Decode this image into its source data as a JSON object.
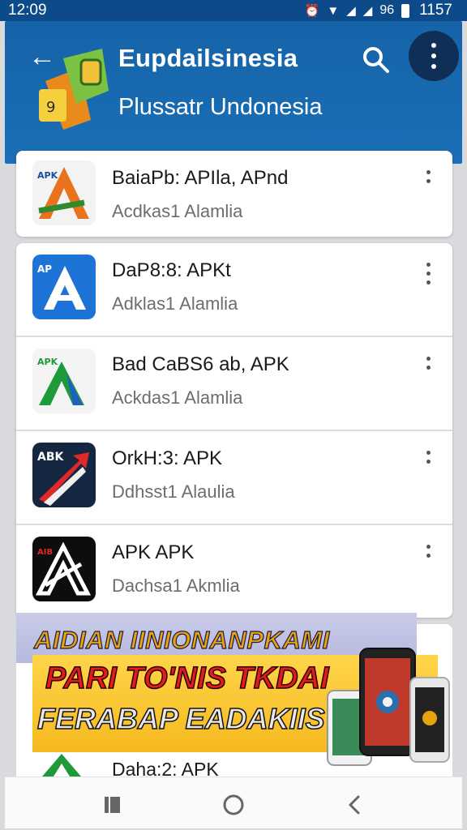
{
  "status_bar": {
    "time": "12:09",
    "right_text": "1157",
    "percent_label": "96",
    "icons": [
      "alarm-icon",
      "wifi-icon",
      "signal-icon",
      "signal-icon-2",
      "battery-icon"
    ]
  },
  "header": {
    "title": "Eupdailsinesia",
    "subtitle": "Plussatr Undonesia",
    "icons": [
      "back-arrow-icon",
      "search-icon",
      "more-vert-icon"
    ],
    "colors": {
      "primary": "#1663a8",
      "status_bar": "#0c4a8a",
      "more_button_bg": "#0f2f57"
    }
  },
  "apps": [
    {
      "name": "BaiaPb: APIla, APnd",
      "meta": "Acdkas1 Alamlia",
      "icon": "apk-orange-a-icon"
    },
    {
      "name": "DaP8:8: APKt",
      "meta": "Adklas1 Alamlia",
      "icon": "apk-blue-a-icon"
    },
    {
      "name": "Bad CaBS6 ab, APK",
      "meta": "Ackdas1 Alamlia",
      "icon": "apk-green-a-icon"
    },
    {
      "name": "OrkH:3: APK",
      "meta": "Ddhsst1 Alaulia",
      "icon": "apk-red-arrow-icon"
    },
    {
      "name": "APK APK",
      "meta": "Dachsa1 Akmlia",
      "icon": "apk-black-a-icon"
    }
  ],
  "banner": {
    "headline": "AIDIAN IINIONANPKAMI",
    "line1": "PARI TO'NIS TKDAI",
    "line2": "FERABAP EADAKIIS"
  },
  "partial_item": {
    "name": "Daha:2: APK"
  },
  "nav": {
    "icons": [
      "recent-apps-icon",
      "home-icon",
      "back-icon"
    ]
  }
}
